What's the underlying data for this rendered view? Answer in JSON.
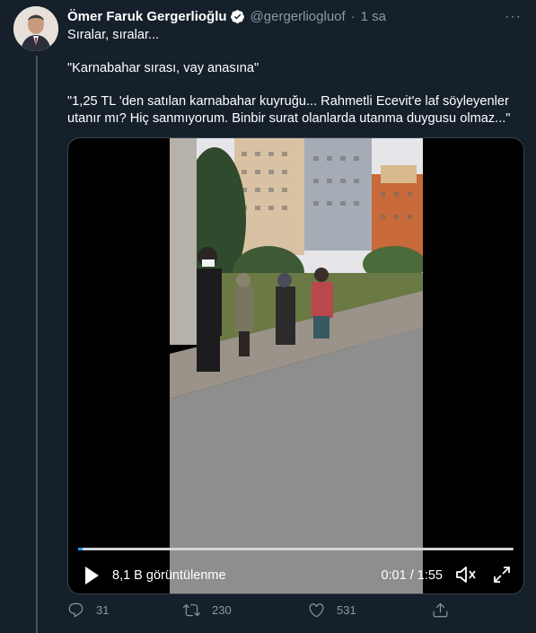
{
  "tweet": {
    "author_name": "Ömer Faruk Gergerlioğlu",
    "handle": "@gergerliogluof",
    "separator": "·",
    "time": "1 sa",
    "more_label": "···",
    "text_p1": "Sıralar, sıralar...",
    "text_p2": "\"Karnabahar sırası, vay anasına\"",
    "text_p3": "\"1,25 TL 'den satılan karnabahar kuyruğu...  Rahmetli Ecevit'e laf söyleyenler utanır mı? Hiç sanmıyorum. Binbir surat olanlarda utanma duygusu olmaz...\""
  },
  "video": {
    "views": "8,1 B görüntülenme",
    "time": "0:01 / 1:55",
    "progress": 0.01
  },
  "actions": {
    "replies": "31",
    "retweets": "230",
    "likes": "531"
  },
  "icons": {
    "verified": "verified-badge-icon",
    "reply": "reply-icon",
    "retweet": "retweet-icon",
    "like": "heart-icon",
    "share": "share-icon",
    "play": "play-icon",
    "volume": "volume-icon",
    "fullscreen": "fullscreen-icon"
  },
  "colors": {
    "background": "#15202b",
    "muted": "#8899a6",
    "accent": "#1da1f2"
  }
}
